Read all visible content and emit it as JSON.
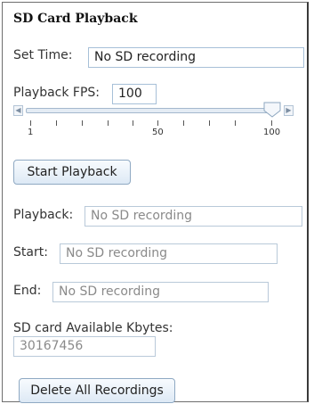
{
  "panel": {
    "title": "SD Card Playback"
  },
  "set_time": {
    "label": "Set Time:",
    "value": "No SD recording"
  },
  "playback_fps": {
    "label": "Playback FPS:",
    "value": "100",
    "slider": {
      "min": 1,
      "max": 100,
      "current": 100,
      "tick_labels": [
        "1",
        "50",
        "100"
      ]
    }
  },
  "buttons": {
    "start_playback": "Start Playback",
    "delete_all": "Delete All Recordings"
  },
  "playback": {
    "label": "Playback:",
    "value": "No SD recording"
  },
  "start": {
    "label": "Start:",
    "value": "No SD recording"
  },
  "end": {
    "label": "End:",
    "value": "No SD recording"
  },
  "sd_available": {
    "label": "SD card Available Kbytes:",
    "value": "30167456"
  },
  "icons": {
    "slider_left": "triangle-left",
    "slider_right": "triangle-right"
  }
}
